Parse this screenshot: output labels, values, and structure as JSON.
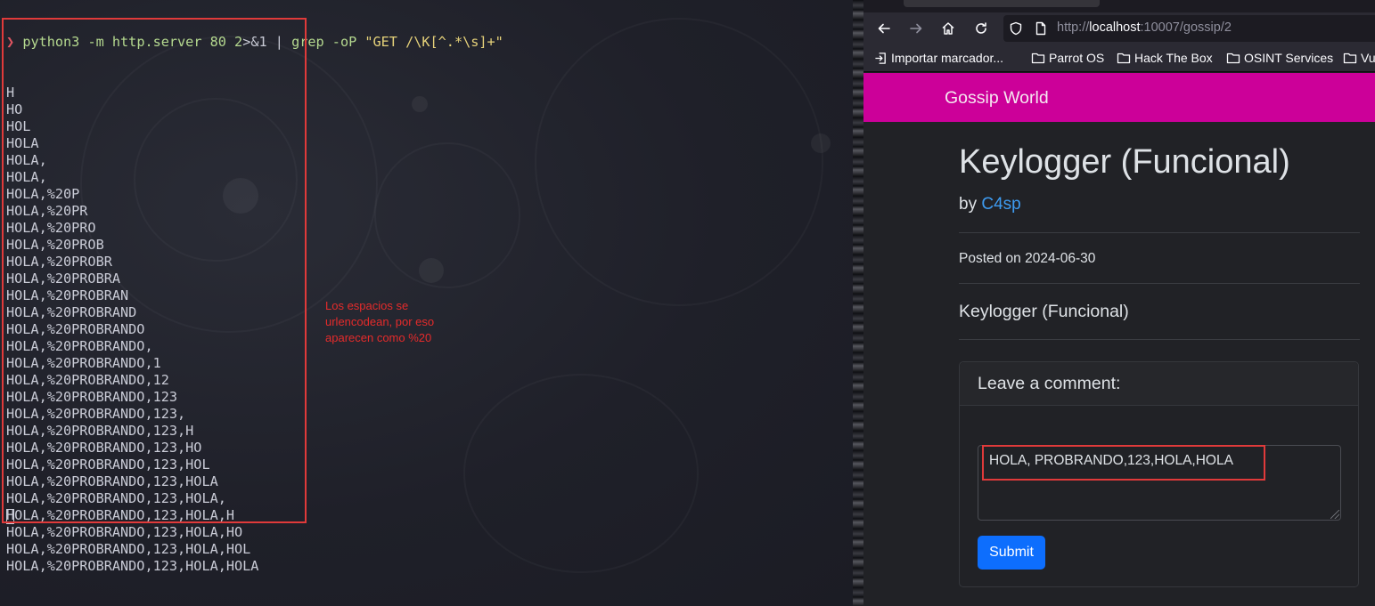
{
  "terminal": {
    "prompt_symbol": "❯",
    "command": {
      "program": "python3 -m http.server 80 2",
      "redirect": ">&1 | ",
      "grep": "grep -oP ",
      "pattern": "\"GET /\\K[^.*\\s]+\""
    },
    "output_lines": [
      "H",
      "HO",
      "HOL",
      "HOLA",
      "HOLA,",
      "HOLA,",
      "HOLA,%20P",
      "HOLA,%20PR",
      "HOLA,%20PRO",
      "HOLA,%20PROB",
      "HOLA,%20PROBR",
      "HOLA,%20PROBRA",
      "HOLA,%20PROBRAN",
      "HOLA,%20PROBRAND",
      "HOLA,%20PROBRANDO",
      "HOLA,%20PROBRANDO,",
      "HOLA,%20PROBRANDO,1",
      "HOLA,%20PROBRANDO,12",
      "HOLA,%20PROBRANDO,123",
      "HOLA,%20PROBRANDO,123,",
      "HOLA,%20PROBRANDO,123,H",
      "HOLA,%20PROBRANDO,123,HO",
      "HOLA,%20PROBRANDO,123,HOL",
      "HOLA,%20PROBRANDO,123,HOLA",
      "HOLA,%20PROBRANDO,123,HOLA,",
      "HOLA,%20PROBRANDO,123,HOLA,H",
      "HOLA,%20PROBRANDO,123,HOLA,HO",
      "HOLA,%20PROBRANDO,123,HOLA,HOL",
      "HOLA,%20PROBRANDO,123,HOLA,HOLA"
    ]
  },
  "annotation": {
    "text": "Los espacios se\nurlencodean, por eso\naparecen como %20",
    "color": "#e52b2b"
  },
  "browser": {
    "url_prefix": "http://",
    "url_host": "localhost",
    "url_path": ":10007/gossip/2",
    "bookmarks": [
      {
        "label": "Importar marcador...",
        "icon": "import-icon"
      },
      {
        "label": "Parrot OS",
        "icon": "folder-icon"
      },
      {
        "label": "Hack The Box",
        "icon": "folder-icon"
      },
      {
        "label": "OSINT Services",
        "icon": "folder-icon"
      },
      {
        "label": "Vu",
        "icon": "folder-icon"
      }
    ]
  },
  "site": {
    "brand": "Gossip World",
    "brand_color": "#cc0099",
    "post": {
      "title": "Keylogger (Funcional)",
      "by_label": "by ",
      "author": "C4sp",
      "date": "Posted on 2024-06-30",
      "content": "Keylogger (Funcional)"
    },
    "comment": {
      "header": "Leave a comment:",
      "textarea_value": "HOLA, PROBRANDO,123,HOLA,HOLA",
      "submit_label": "Submit"
    }
  }
}
